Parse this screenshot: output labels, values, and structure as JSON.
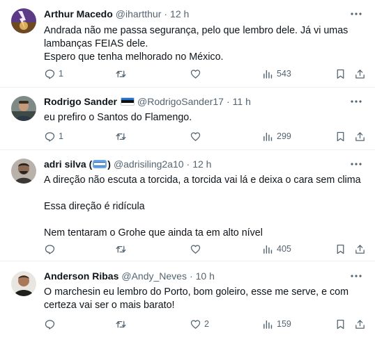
{
  "tweets": [
    {
      "name": "Arthur Macedo",
      "handle": "@ihartthur",
      "time": "12 h",
      "lines": [
        "Andrada não me passa segurança, pelo que lembro dele. Já vi umas",
        "lambanças FEIAS dele.",
        "Espero que tenha melhorado no México."
      ],
      "replies": "1",
      "retweets": "",
      "likes": "",
      "views": "543"
    },
    {
      "name": "Rodrigo Sander",
      "name_flag": "estonia-flag",
      "handle": "@RodrigoSander17",
      "time": "11 h",
      "lines": [
        "eu prefiro o Santos do Flamengo."
      ],
      "replies": "1",
      "retweets": "",
      "likes": "",
      "views": "299"
    },
    {
      "name_prefix": "adri silva (",
      "name_badge": "botswana-flag",
      "name_suffix": ")",
      "handle": "@adrisiling2a10",
      "time": "12 h",
      "lines": [
        "A direção não escuta a torcida, a torcida  vai lá e deixa o cara sem clima",
        "",
        "Essa direção é ridícula",
        "",
        "Nem tentaram o Grohe que ainda ta em alto nível"
      ],
      "replies": "",
      "retweets": "",
      "likes": "",
      "views": "405"
    },
    {
      "name": "Anderson Ribas",
      "handle": "@Andy_Neves",
      "time": "10 h",
      "lines": [
        "O marchesin eu lembro do Porto, bom goleiro, esse me serve, e com",
        "certeza vai ser o mais barato!"
      ],
      "replies": "",
      "retweets": "",
      "likes": "2",
      "views": "159"
    }
  ],
  "icons": {
    "reply": "reply-icon",
    "retweet": "retweet-icon",
    "like": "like-icon",
    "views": "views-icon",
    "bookmark": "bookmark-icon",
    "share": "share-icon",
    "more": "more-icon"
  },
  "colors": {
    "text": "#0f1419",
    "secondary": "#536471",
    "divider": "#eff3f4"
  }
}
